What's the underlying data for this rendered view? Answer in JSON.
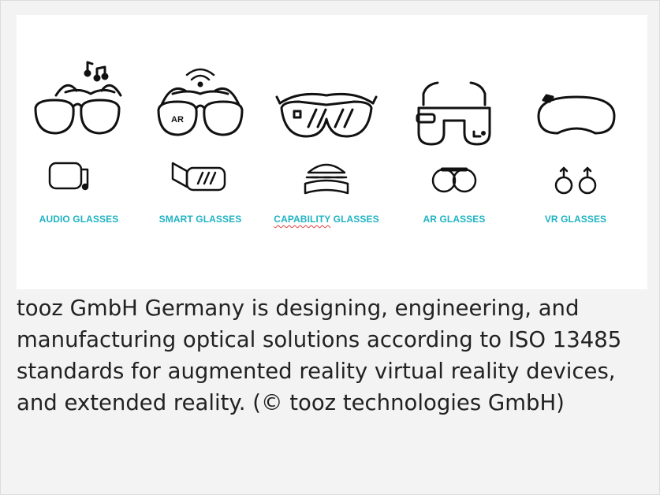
{
  "categories": [
    {
      "label": "AUDIO GLASSES",
      "main_icon": "audio-glasses-icon",
      "sub_icon": "ear-speaker-lens-icon",
      "underline": false
    },
    {
      "label": "SMART GLASSES",
      "main_icon": "smart-glasses-icon",
      "sub_icon": "projector-lens-icon",
      "underline": false,
      "badge": "AR"
    },
    {
      "label_main": "CAPABILITY",
      "label_rest": " GLASSES",
      "main_icon": "capability-glasses-icon",
      "sub_icon": "layered-lens-icon",
      "underline": true
    },
    {
      "label": "AR GLASSES",
      "main_icon": "ar-glasses-icon",
      "sub_icon": "binocular-lens-icon",
      "underline": false
    },
    {
      "label": "VR GLASSES",
      "main_icon": "vr-headset-icon",
      "sub_icon": "eye-tracking-lens-icon",
      "underline": false
    }
  ],
  "colors": {
    "label": "#1fb3c3",
    "icon_stroke": "#111111"
  },
  "caption": "tooz GmbH Germany is designing, engineering, and manufacturing optical solutions according to ISO 13485 standards for augmented reality virtual reality devices, and extended reality. (© tooz technologies GmbH)"
}
